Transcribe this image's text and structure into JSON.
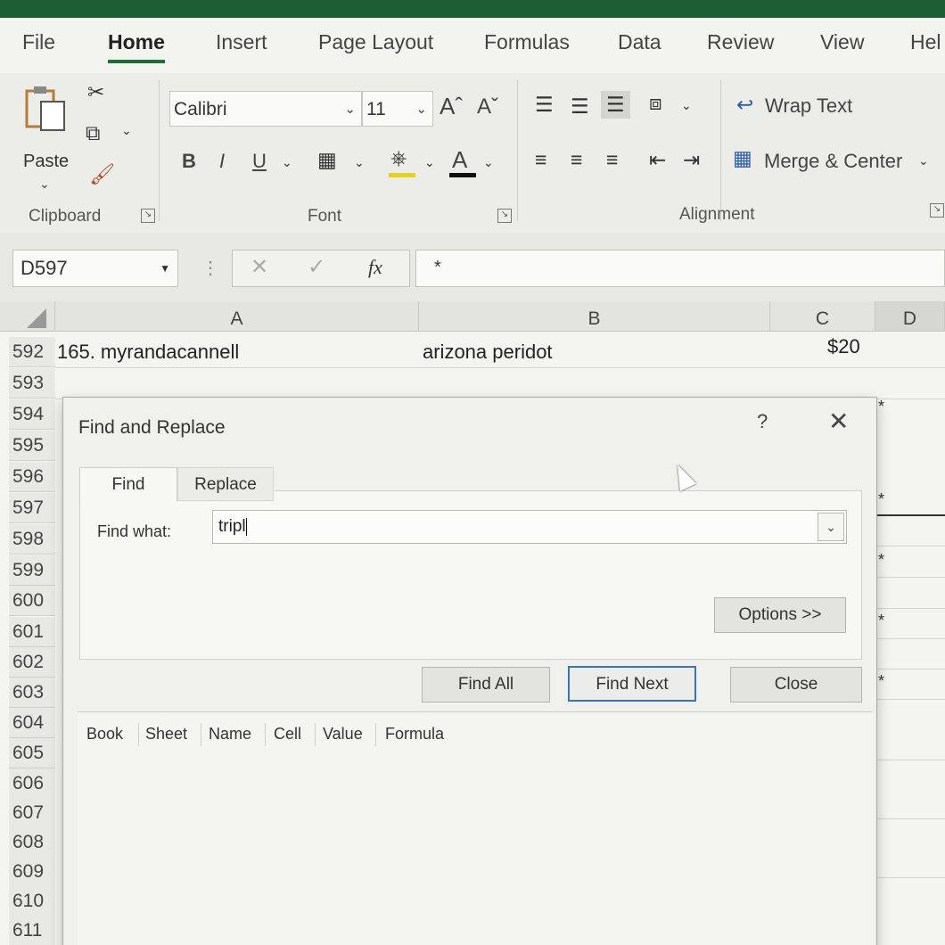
{
  "ribbon_tabs": [
    "File",
    "Home",
    "Insert",
    "Page Layout",
    "Formulas",
    "Data",
    "Review",
    "View",
    "Hel"
  ],
  "clipboard": {
    "paste": "Paste",
    "label": "Clipboard"
  },
  "font": {
    "name": "Calibri",
    "size": "11",
    "label": "Font",
    "bold": "B",
    "italic": "I",
    "underline": "U",
    "grow": "Aˆ",
    "shrink": "Aˇ",
    "color": "A"
  },
  "alignment": {
    "wrap": "Wrap Text",
    "merge": "Merge & Center",
    "label": "Alignment"
  },
  "formula_bar": {
    "name_box": "D597",
    "fx": "fx",
    "value": "*"
  },
  "columns": [
    "A",
    "B",
    "C",
    "D"
  ],
  "rows": [
    "592",
    "593",
    "594",
    "595",
    "596",
    "597",
    "598",
    "599",
    "600",
    "601",
    "602",
    "603",
    "604",
    "605",
    "606",
    "607",
    "608",
    "609",
    "610",
    "611"
  ],
  "cells": {
    "a592": "165. myrandacannell",
    "b592": "arizona peridot",
    "c592": "$20"
  },
  "stars": [
    "*",
    "*",
    "*",
    "*",
    "*"
  ],
  "dialog": {
    "title": "Find and Replace",
    "help": "?",
    "close_glyph": "✕",
    "tabs": [
      "Find",
      "Replace"
    ],
    "find_label": "Find what:",
    "find_value": "tripl",
    "options": "Options >>",
    "find_all": "Find All",
    "find_next": "Find Next",
    "close": "Close",
    "result_columns": [
      "Book",
      "Sheet",
      "Name",
      "Cell",
      "Value",
      "Formula"
    ]
  }
}
